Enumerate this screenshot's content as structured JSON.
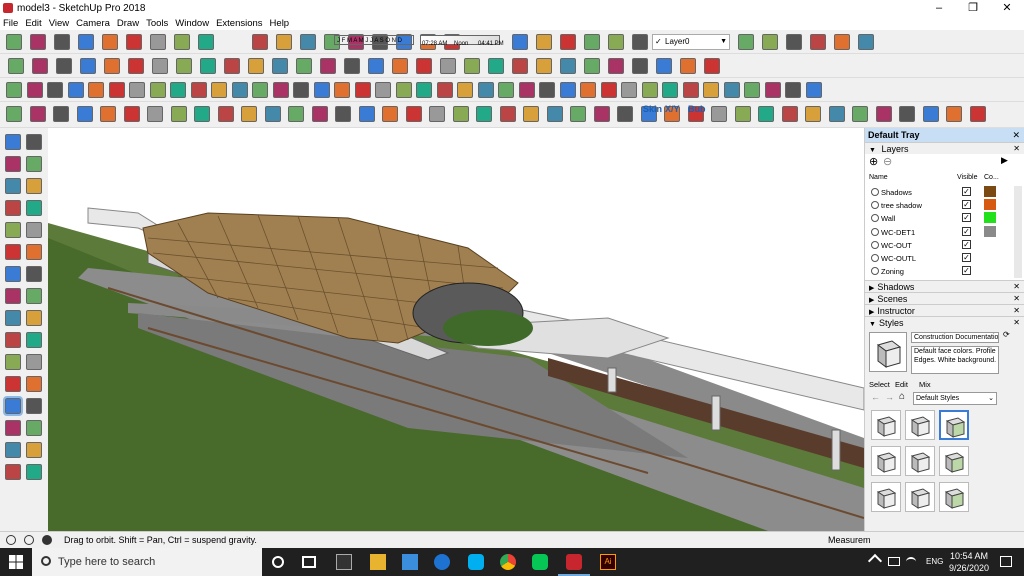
{
  "window": {
    "title": "model3 - SketchUp Pro 2018",
    "minimize": "–",
    "maximize": "❐",
    "close": "✕"
  },
  "menu": [
    "File",
    "Edit",
    "View",
    "Camera",
    "Draw",
    "Tools",
    "Window",
    "Extensions",
    "Help"
  ],
  "shadow_toolbar": {
    "months": "J F M A M J J A S O N D",
    "time_start": "07:28 AM",
    "time_mid": "Noon",
    "time_end": "04:41 PM"
  },
  "layer_dropdown": {
    "value": "Layer0",
    "check": "✓"
  },
  "plugin_labels": [
    "Skin",
    "X/Y",
    "Bub"
  ],
  "tray": {
    "title": "Default Tray",
    "layers": {
      "header": "Layers",
      "col_name": "Name",
      "col_visible": "Visible",
      "col_color": "Co...",
      "rows": [
        {
          "name": "Shadows",
          "visible": true,
          "color": "#7a4a12"
        },
        {
          "name": "tree shadow",
          "visible": true,
          "color": "#d65a12"
        },
        {
          "name": "Wall",
          "visible": true,
          "color": "#22e019"
        },
        {
          "name": "WC-DET1",
          "visible": true,
          "color": "#8a8a8a"
        },
        {
          "name": "WC-OUT",
          "visible": true,
          "color": "#ffffff"
        },
        {
          "name": "WC-OUTL",
          "visible": true,
          "color": "#ffffff"
        },
        {
          "name": "Zoning",
          "visible": true,
          "color": "#ffffff"
        }
      ]
    },
    "collapsed": [
      "Shadows",
      "Scenes",
      "Instructor"
    ],
    "styles": {
      "header": "Styles",
      "name": "Construction Documentation",
      "description": "Default face colors. Profile Edges. White background.",
      "tabs": [
        "Select",
        "Edit",
        "Mix"
      ],
      "library": "Default Styles"
    }
  },
  "status": {
    "message": "Drag to orbit. Shift = Pan, Ctrl = suspend gravity.",
    "measurements": "Measurem"
  },
  "taskbar": {
    "search_placeholder": "Type here to search",
    "time": "10:54 AM",
    "date": "9/26/2020",
    "lang": "ENG"
  },
  "colors": {
    "accent": "#c7def5",
    "ground_green": "#5c7a3a",
    "roof": "#a08050",
    "road": "#8c8c8c"
  }
}
